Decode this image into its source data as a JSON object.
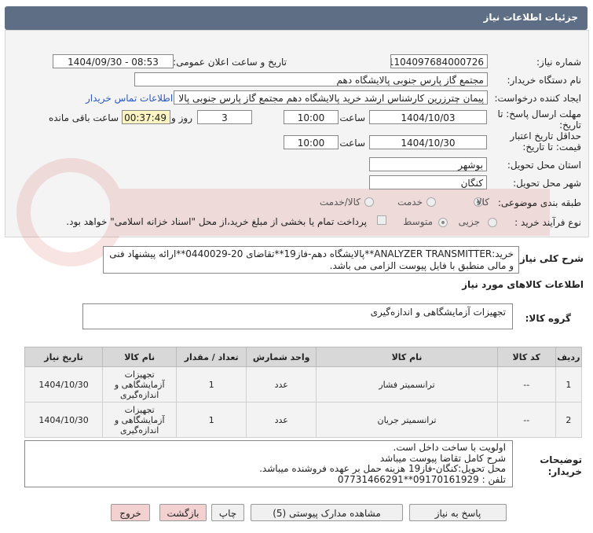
{
  "header": {
    "title": "جزئیات اطلاعات نیاز"
  },
  "form": {
    "need_number_label": "شماره نیاز:",
    "need_number": "1104097684000726",
    "announce_label": "تاریخ و ساعت اعلان عمومی:",
    "announce_value": "1404/09/30 - 08:53",
    "buyer_label": "نام دستگاه خریدار:",
    "buyer_value": "مجتمع گاز پارس جنوبی  پالایشگاه دهم",
    "creator_label": "ایجاد کننده درخواست:",
    "creator_value": "پیمان چترزرین کارشناس ارشد خرید پالایشگاه دهم مجتمع گاز پارس جنوبی  پالا",
    "contact_link": "اطلاعات تماس خریدار",
    "send_deadline_label": "مهلت ارسال پاسخ: تا تاریخ:",
    "send_date": "1404/10/03",
    "time_label": "ساعت",
    "send_time": "10:00",
    "days": "3",
    "days_label": "روز و",
    "remaining": "00:37:49",
    "remaining_label": "ساعت باقی مانده",
    "validity_label": "حداقل تاریخ اعتبار قیمت: تا تاریخ:",
    "validity_date": "1404/10/30",
    "validity_time": "10:00",
    "province_label": "استان محل تحویل:",
    "province": "بوشهر",
    "city_label": "شهر محل تحویل:",
    "city": "کنگان",
    "category_label": "طبقه بندی موضوعی:",
    "category_options": [
      "کالا",
      "خدمت",
      "کالا/خدمت"
    ],
    "process_label": "نوع فرآیند خرید :",
    "process_options": [
      "جزیی",
      "متوسط"
    ],
    "payment_note": "پرداخت تمام یا بخشی از مبلغ خرید،از محل \"اسناد خزانه اسلامی\" خواهد بود."
  },
  "description": {
    "label": "شرح کلی نیاز:",
    "text": "خرید:ANALYZER TRANSMITTER**پالایشگاه دهم-فاز19**تقاضای 20-0440029**ارائه پیشنهاد فنی و مالی منطبق با فایل پیوست الزامی می باشد."
  },
  "goods": {
    "section_title": "اطلاعات کالاهای مورد نیاز",
    "group_label": "گروه کالا:",
    "group_value": "تجهیزات آزمایشگاهی و اندازه‌گیری",
    "columns": [
      "ردیف",
      "کد کالا",
      "نام کالا",
      "واحد شمارش",
      "تعداد / مقدار",
      "نام کالا",
      "تاریخ نیاز"
    ],
    "rows": [
      {
        "row": "1",
        "code": "--",
        "name": "ترانسمیتر فشار",
        "unit": "عدد",
        "qty": "1",
        "group": "تجهیزات آزمایشگاهی و اندازه‌گیری",
        "date": "1404/10/30"
      },
      {
        "row": "2",
        "code": "--",
        "name": "ترانسمیتر جریان",
        "unit": "عدد",
        "qty": "1",
        "group": "تجهیزات آزمایشگاهی و اندازه‌گیری",
        "date": "1404/10/30"
      }
    ]
  },
  "buyer_notes": {
    "label": "توضیحات خریدار:",
    "lines": [
      "اولویت با ساخت داخل است.",
      "شرح کامل تقاضا پیوست میباشد",
      "محل تحویل:کنگان-فاز19 هزینه حمل بر عهده فروشنده میباشد.",
      "تلفن : 09170161929**07731466291"
    ]
  },
  "buttons": {
    "reply": "پاسخ به نیاز",
    "attachments": "مشاهده مدارک پیوستی (5)",
    "print": "چاپ",
    "back": "بازگشت",
    "exit": "خروج"
  }
}
